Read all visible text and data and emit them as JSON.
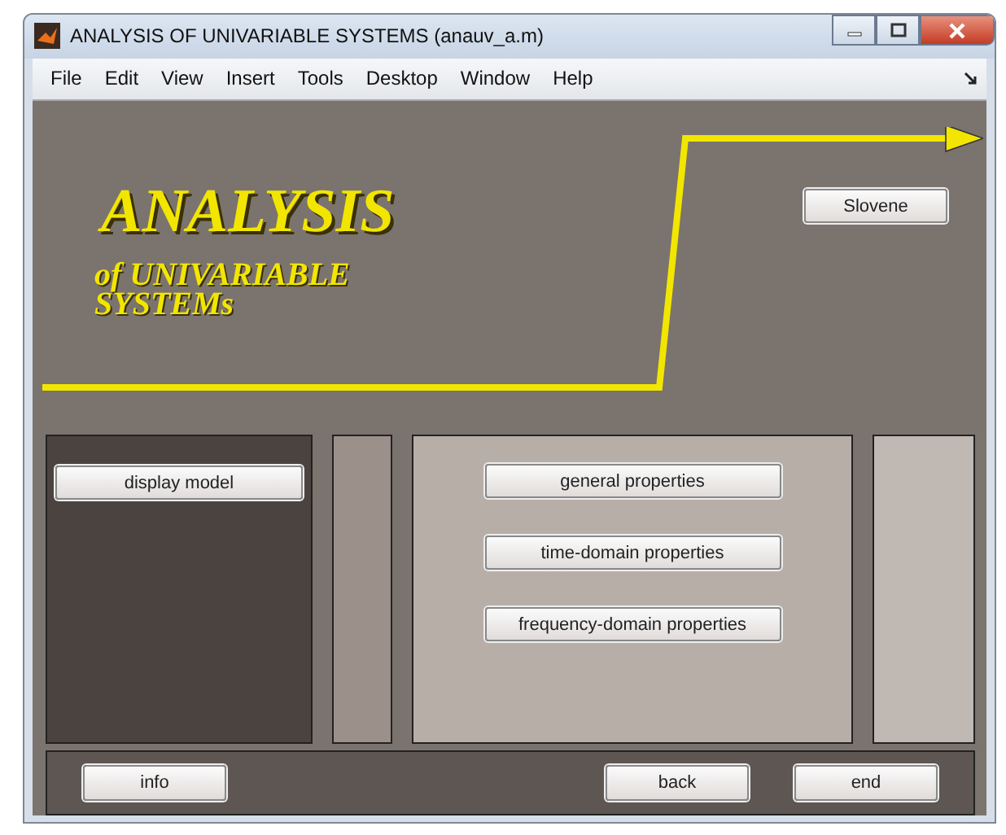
{
  "window": {
    "title": "ANALYSIS OF UNIVARIABLE SYSTEMS (anauv_a.m)"
  },
  "menu": [
    "File",
    "Edit",
    "View",
    "Insert",
    "Tools",
    "Desktop",
    "Window",
    "Help"
  ],
  "banner": {
    "title": "ANALYSIS",
    "subtitle": [
      "of UNIVARIABLE",
      "SYSTEMs"
    ],
    "language_button": "Slovene"
  },
  "panels": [
    {
      "kind": "dark",
      "buttons": [
        "display model"
      ]
    },
    {
      "kind": "narrow"
    },
    {
      "kind": "light",
      "buttons": [
        "general properties",
        "time-domain properties",
        "frequency-domain properties"
      ]
    },
    {
      "kind": "side"
    }
  ],
  "bottom_bar": {
    "left_buttons": [
      "info"
    ],
    "right_buttons": [
      "back",
      "end"
    ]
  }
}
